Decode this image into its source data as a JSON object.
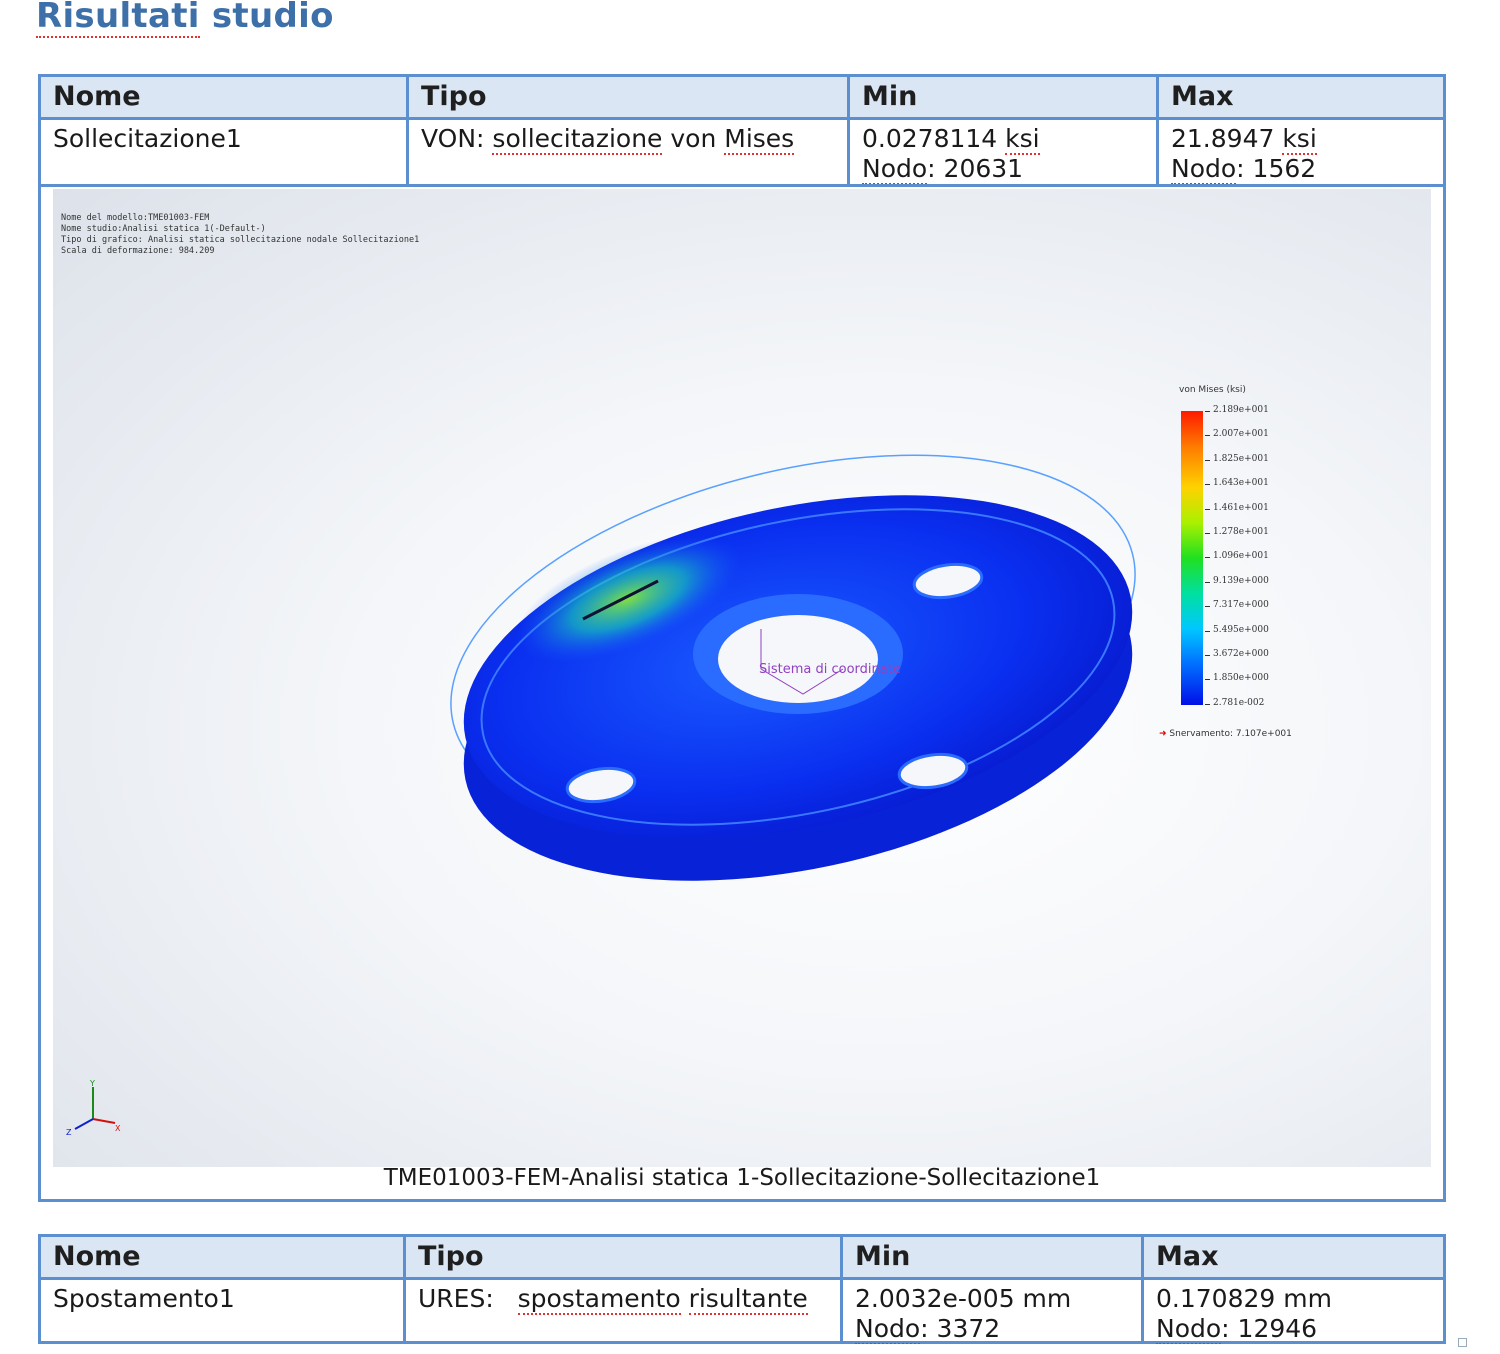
{
  "heading": {
    "word": "Risultati",
    "rest": " studio"
  },
  "table1": {
    "headers": {
      "nome": "Nome",
      "tipo": "Tipo",
      "min": "Min",
      "max": "Max"
    },
    "row": {
      "nome": "Sollecitazione1",
      "tipo_prefix": "VON: ",
      "tipo_word": "sollecitazione",
      "tipo_mid": " von ",
      "tipo_word2": "Mises",
      "min_value": "0.0278114 ",
      "min_unit": "ksi",
      "min_node_label": "Nodo",
      "min_node": ": 20631",
      "max_value": "21.8947 ",
      "max_unit": "ksi",
      "max_node_label": "Nodo",
      "max_node": ": 1562"
    },
    "figure": {
      "meta_line1": "Nome del modello:TME01003-FEM",
      "meta_line2": "Nome studio:Analisi statica 1(-Default-)",
      "meta_line3": "Tipo di grafico: Analisi statica sollecitazione nodale Sollecitazione1",
      "meta_line4": "Scala di deformazione: 984.209",
      "legend_title": "von Mises (ksi)",
      "ticks": [
        "2.189e+001",
        "2.007e+001",
        "1.825e+001",
        "1.643e+001",
        "1.461e+001",
        "1.278e+001",
        "1.096e+001",
        "9.139e+000",
        "7.317e+000",
        "5.495e+000",
        "3.672e+000",
        "1.850e+000",
        "2.781e-002"
      ],
      "yield_label": "Snervamento: 7.107e+001",
      "coord_label": "Sistema di coordinate",
      "caption": "TME01003-FEM-Analisi statica 1-Sollecitazione-Sollecitazione1"
    }
  },
  "table2": {
    "headers": {
      "nome": "Nome",
      "tipo": "Tipo",
      "min": "Min",
      "max": "Max"
    },
    "row": {
      "nome": "Spostamento1",
      "tipo_prefix": "URES:   ",
      "tipo_word": "spostamento",
      "tipo_mid": " ",
      "tipo_word2": "risultante",
      "min_value": "2.0032e-005 mm",
      "min_node_label": "Nodo",
      "min_node": ": 3372",
      "max_value": "0.170829 mm",
      "max_node_label": "Nodo",
      "max_node": ": 12946"
    }
  },
  "colors": {
    "accent": "#5b8fd0",
    "title": "#3d6fa8",
    "header_bg": "#dbe6f4"
  }
}
